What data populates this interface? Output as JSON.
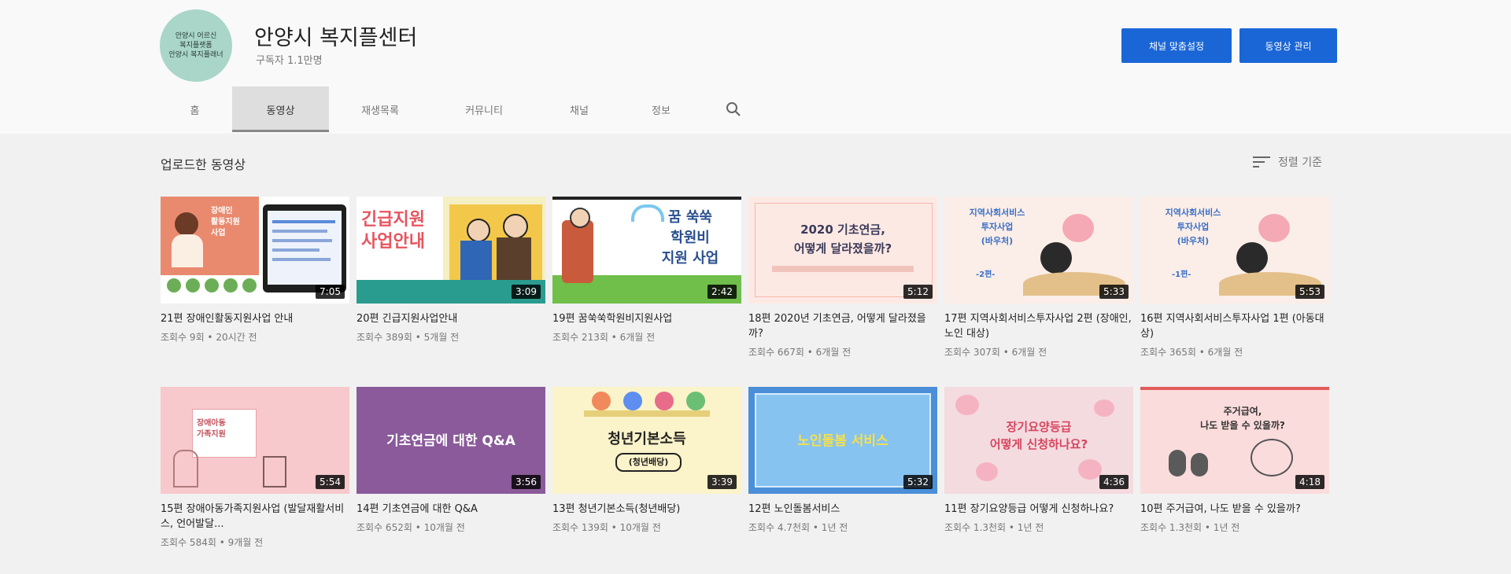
{
  "channel": {
    "avatar_lines": [
      "안양시 어르신",
      "복지플랫폼",
      "안양시 복지플래너"
    ],
    "name": "안양시 복지플센터",
    "subscribers": "구독자 1.1만명"
  },
  "buttons": {
    "customize": "채널 맞춤설정",
    "manage": "동영상 관리"
  },
  "tabs": [
    "홈",
    "동영상",
    "재생목록",
    "커뮤니티",
    "채널",
    "정보"
  ],
  "active_tab": "동영상",
  "section": {
    "title": "업로드한 동영상",
    "sort_label": "정렬 기준"
  },
  "videos": [
    {
      "title": "21편 장애인활동지원사업 안내",
      "meta": "조회수 9회 • 20시간 전",
      "duration": "7:05",
      "thumb_text": [
        "장애인",
        "활동지원",
        "사업"
      ]
    },
    {
      "title": "20편 긴급지원사업안내",
      "meta": "조회수 389회 • 5개월 전",
      "duration": "3:09",
      "thumb_text": [
        "긴급지원",
        "사업안내"
      ]
    },
    {
      "title": "19편 꿈쑥쑥학원비지원사업",
      "meta": "조회수 213회 • 6개월 전",
      "duration": "2:42",
      "thumb_text": [
        "꿈 쑥쑥",
        "학원비",
        "지원 사업"
      ]
    },
    {
      "title": "18편 2020년 기초연금, 어떻게 달라졌을까?",
      "meta": "조회수 667회 • 6개월 전",
      "duration": "5:12",
      "thumb_text": [
        "2020 기초연금,",
        "어떻게 달라졌을까?"
      ]
    },
    {
      "title": "17편 지역사회서비스투자사업 2편 (장애인, 노인 대상)",
      "meta": "조회수 307회 • 6개월 전",
      "duration": "5:33",
      "thumb_text": [
        "지역사회서비스",
        "투자사업",
        "(바우처)",
        "-2편-"
      ]
    },
    {
      "title": "16편 지역사회서비스투자사업 1편 (아동대상)",
      "meta": "조회수 365회 • 6개월 전",
      "duration": "5:53",
      "thumb_text": [
        "지역사회서비스",
        "투자사업",
        "(바우처)",
        "-1편-"
      ]
    },
    {
      "title": "15편 장애아동가족지원사업 (발달재활서비스, 언어발달...",
      "meta": "조회수 584회 • 9개월 전",
      "duration": "5:54",
      "thumb_text": [
        "장애아동",
        "가족지원"
      ]
    },
    {
      "title": "14편 기초연금에 대한 Q&A",
      "meta": "조회수 652회 • 10개월 전",
      "duration": "3:56",
      "thumb_text": [
        "기초연금에 대한 Q&A"
      ]
    },
    {
      "title": "13편 청년기본소득(청년배당)",
      "meta": "조회수 139회 • 10개월 전",
      "duration": "3:39",
      "thumb_text": [
        "청년기본소득",
        "(청년배당)"
      ]
    },
    {
      "title": "12편 노인돌봄서비스",
      "meta": "조회수 4.7천회 • 1년 전",
      "duration": "5:32",
      "thumb_text": [
        "노인돌봄 서비스"
      ]
    },
    {
      "title": "11편 장기요양등급 어떻게 신청하나요?",
      "meta": "조회수 1.3천회 • 1년 전",
      "duration": "4:36",
      "thumb_text": [
        "장기요양등급",
        "어떻게 신청하나요?"
      ]
    },
    {
      "title": "10편 주거급여, 나도 받을 수 있을까?",
      "meta": "조회수 1.3천회 • 1년 전",
      "duration": "4:18",
      "thumb_text": [
        "주거급여,",
        "나도 받을 수 있을까?"
      ]
    }
  ]
}
